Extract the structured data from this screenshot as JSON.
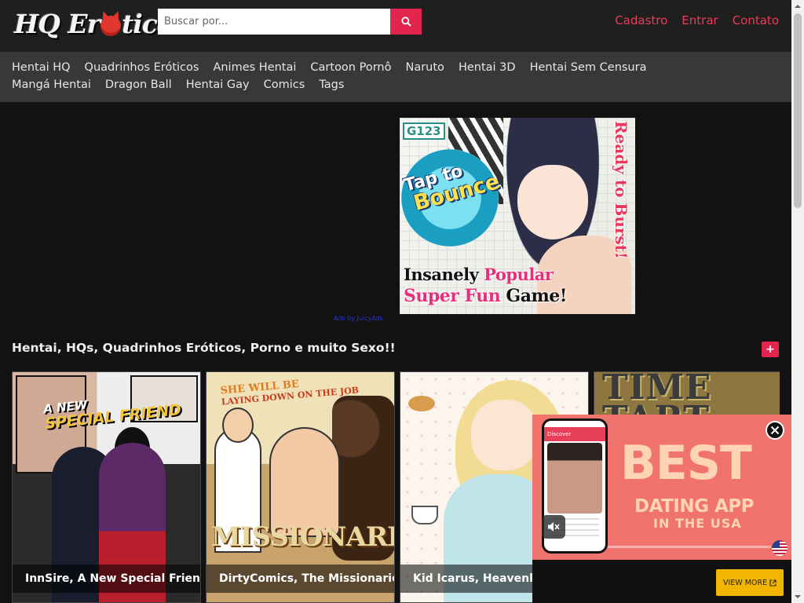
{
  "header": {
    "logo": {
      "part1": "HQ Er",
      "part2": "tica"
    },
    "search": {
      "placeholder": "Buscar por..."
    },
    "links": [
      "Cadastro",
      "Entrar",
      "Contato"
    ]
  },
  "nav": {
    "items": [
      "Hentai HQ",
      "Quadrinhos Eróticos",
      "Animes Hentai",
      "Cartoon Pornô",
      "Naruto",
      "Hentai 3D",
      "Hentai Sem Censura",
      "Mangá Hentai",
      "Dragon Ball",
      "Hentai Gay",
      "Comics",
      "Tags"
    ]
  },
  "ad_banner": {
    "brand": "G123",
    "tap": "Tap to",
    "bounce": "Bounce",
    "ready": "Ready to Burst!",
    "line1_a": "Insanely ",
    "line1_b": "Popular",
    "line2_a": "Super Fun",
    "line2_b": " Game!",
    "ads_by": "Ads by JuicyAds"
  },
  "section": {
    "title": "Hentai, HQs, Quadrinhos Eróticos, Porno e muito Sexo!!",
    "more_label": "+"
  },
  "cards": [
    {
      "caption": "InnSire, A New Special Friend",
      "art_text_1": "A NEW",
      "art_text_2": "SPECIAL FRIEND"
    },
    {
      "caption": "DirtyComics, The Missionaries",
      "art_text_1": "SHE WILL BE",
      "art_text_2": "LAYING DOWN ON THE JOB",
      "art_text_3": "MISSIONARIE"
    },
    {
      "caption": "Kid Icarus, Heavenly br"
    },
    {
      "caption": "",
      "art_text_1": "TIME",
      "art_text_2": "TART"
    }
  ],
  "popup_ad": {
    "phone_header": "Discover",
    "headline": "BEST",
    "subline": "DATING APP",
    "location": "IN THE USA",
    "cta": "VIEW MORE",
    "video_progress": 0.0,
    "colors": {
      "background": "#f0736e",
      "text": "#ffd3b6",
      "cta": "#f2b600"
    },
    "icons": [
      "mute-icon",
      "close-icon",
      "us-flag-icon",
      "external-link-icon"
    ]
  },
  "colors": {
    "accent": "#e2254f",
    "header_bg": "#1f1f1f",
    "nav_bg": "#383838",
    "page_bg": "#121212"
  }
}
